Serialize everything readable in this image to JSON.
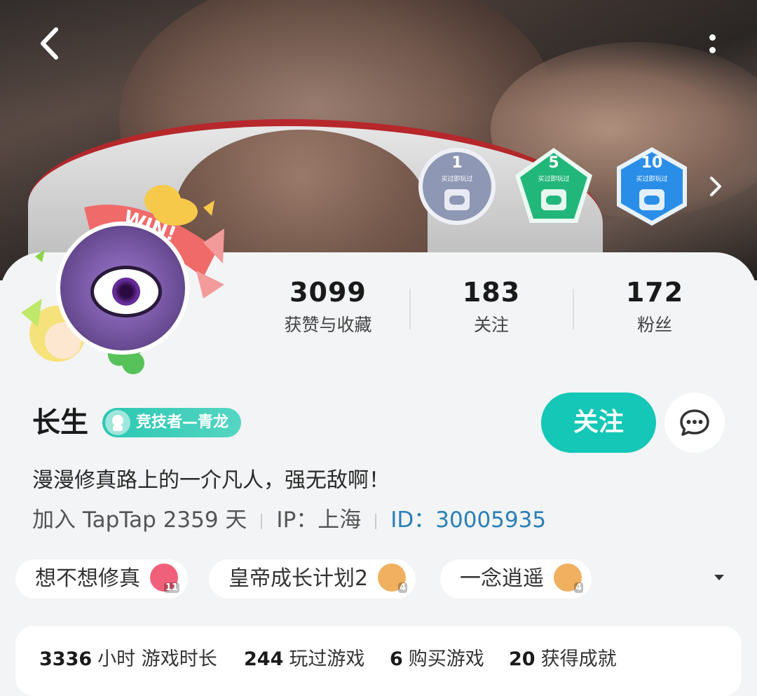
{
  "header": {
    "badges": [
      {
        "num": "1",
        "caption": "买过即玩过",
        "color": "#8e97b4"
      },
      {
        "num": "5",
        "caption": "买过即玩过",
        "color": "#22b77a"
      },
      {
        "num": "10",
        "caption": "买过即玩过",
        "color": "#2a8ee8"
      }
    ]
  },
  "avatar": {
    "frame_text": "WIN!"
  },
  "stats": [
    {
      "value": "3099",
      "label": "获赞与收藏"
    },
    {
      "value": "183",
      "label": "关注"
    },
    {
      "value": "172",
      "label": "粉丝"
    }
  ],
  "profile": {
    "name": "长生",
    "title_tag": "竞技者—青龙",
    "bio": "漫漫修真路上的一介凡人，强无敌啊！",
    "joined": "加入 TapTap 2359 天",
    "ip": "IP：上海",
    "id": "ID：30005935"
  },
  "actions": {
    "follow_label": "关注"
  },
  "games": [
    {
      "name": "想不想修真",
      "level": "11",
      "color": "#f0607a"
    },
    {
      "name": "皇帝成长计划2",
      "level": "4",
      "color": "#f0b060"
    },
    {
      "name": "一念逍遥",
      "level": "4",
      "color": "#f0b060"
    }
  ],
  "play_stats": [
    {
      "value": "3336",
      "label": "小时 游戏时长"
    },
    {
      "value": "244",
      "label": "玩过游戏"
    },
    {
      "value": "6",
      "label": "购买游戏"
    },
    {
      "value": "20",
      "label": "获得成就"
    }
  ],
  "colors": {
    "accent": "#14c7b7",
    "link": "#2a7fb8"
  }
}
